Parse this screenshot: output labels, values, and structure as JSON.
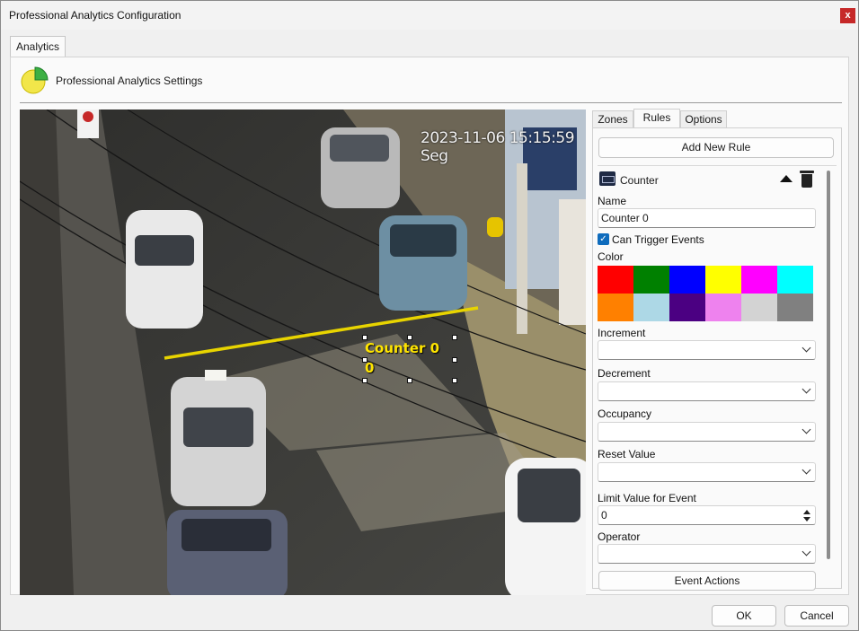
{
  "window": {
    "title": "Professional Analytics Configuration",
    "close_glyph": "x"
  },
  "top_tab": {
    "label": "Analytics"
  },
  "settings": {
    "title": "Professional Analytics Settings",
    "icon": "pie-chart-icon"
  },
  "video": {
    "timestamp": "2023-11-06 15:15:59 Seg",
    "overlay_label": "Counter 0",
    "overlay_value": "0",
    "line_color": "#e8d400"
  },
  "side_tabs": [
    "Zones",
    "Rules",
    "Options"
  ],
  "active_side_tab": "Rules",
  "add_rule_label": "Add New Rule",
  "rule": {
    "type_label": "Counter",
    "name_label": "Name",
    "name_value": "Counter 0",
    "can_trigger_label": "Can Trigger Events",
    "can_trigger_checked": true,
    "color_label": "Color",
    "colors": [
      "#ff0000",
      "#008000",
      "#0000ff",
      "#ffff00",
      "#ff00ff",
      "#00ffff",
      "#ff8000",
      "#add8e6",
      "#4b0082",
      "#ee82ee",
      "#d3d3d3",
      "#808080"
    ],
    "increment_label": "Increment",
    "increment_value": "",
    "decrement_label": "Decrement",
    "decrement_value": "",
    "occupancy_label": "Occupancy",
    "occupancy_value": "",
    "reset_label": "Reset Value",
    "reset_value": "",
    "limit_label": "Limit Value for Event",
    "limit_value": "0",
    "operator_label": "Operator",
    "operator_value": "",
    "event_actions_label": "Event Actions"
  },
  "footer": {
    "ok_label": "OK",
    "cancel_label": "Cancel"
  }
}
